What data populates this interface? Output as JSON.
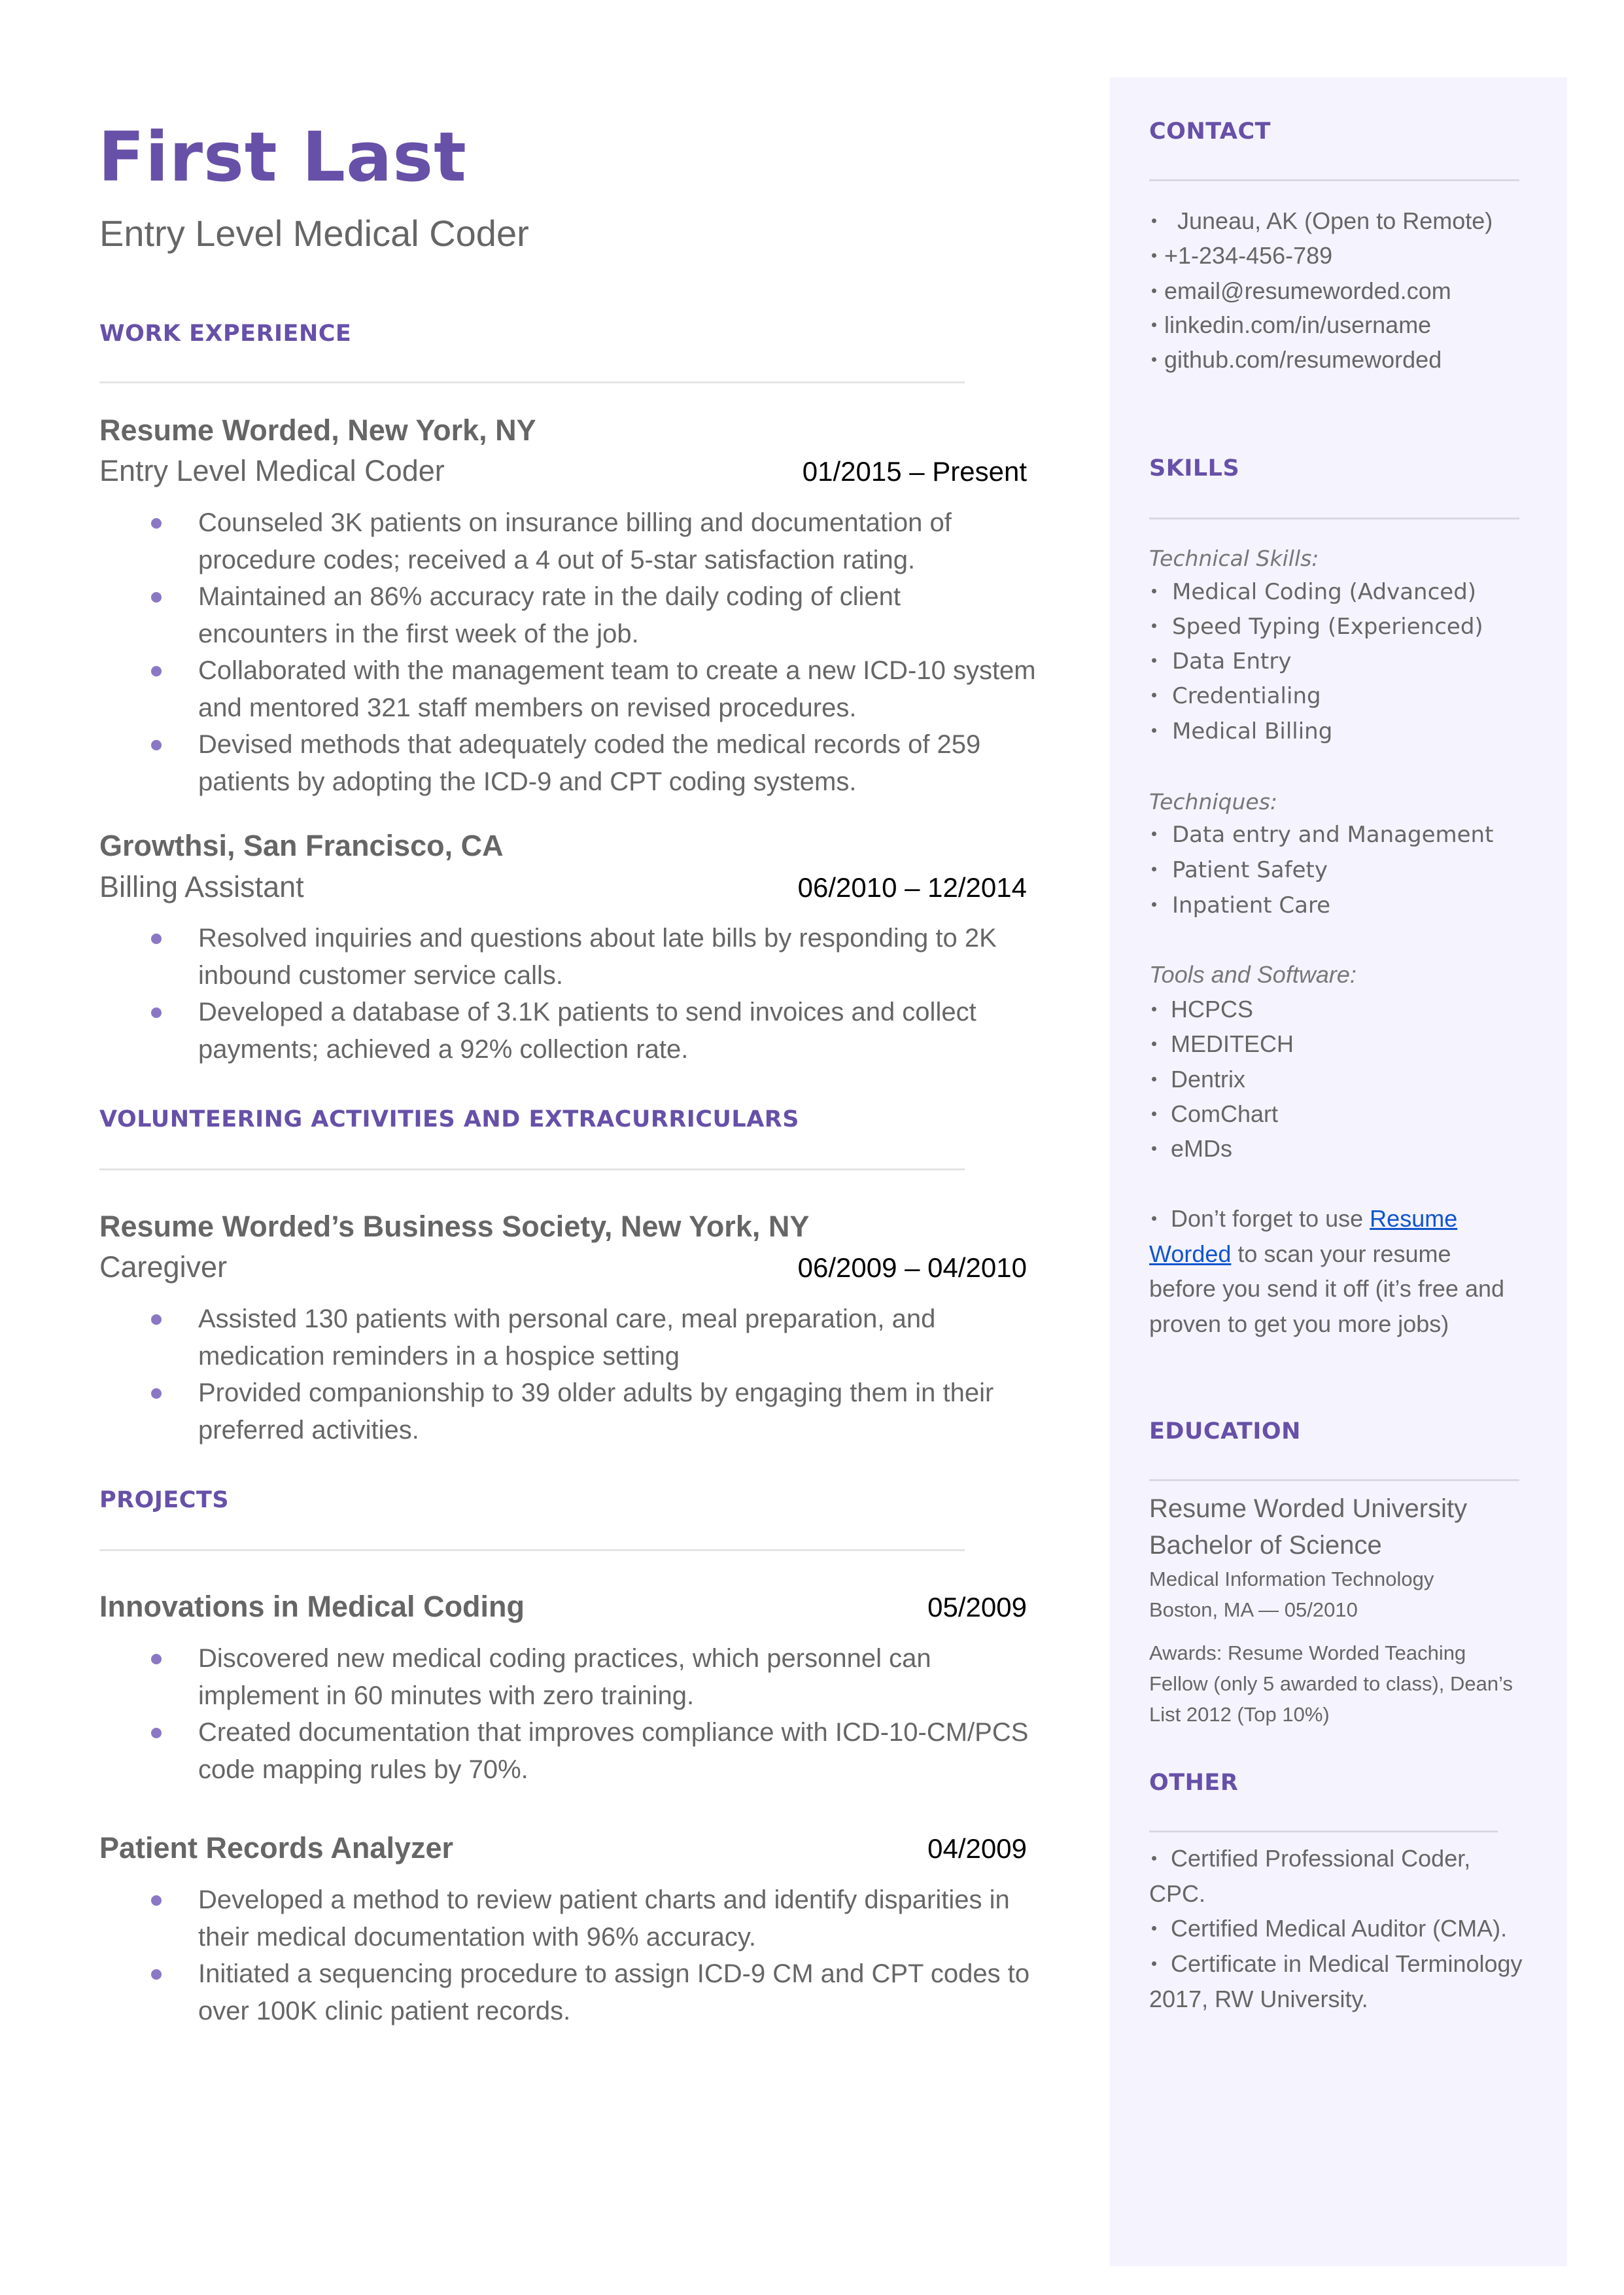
{
  "header": {
    "name": "First Last",
    "headline": "Entry Level Medical Coder"
  },
  "colors": {
    "accent": "#6750a8",
    "bullet": "#8b78c4",
    "sidebar_bg": "#f5f3fe",
    "link": "#1155cc",
    "text": "#666666"
  },
  "work": {
    "title": "WORK EXPERIENCE",
    "jobs": [
      {
        "org": "Resume Worded, New York, NY",
        "role": "Entry Level Medical Coder",
        "dates": "01/2015 – Present",
        "bullets": [
          "Counseled 3K patients on insurance billing and documentation of procedure codes; received a 4 out of 5-star satisfaction rating.",
          "Maintained an 86% accuracy rate in the daily coding of client encounters in the first week of the job.",
          "Collaborated with the management team to create a new ICD-10 system and mentored 321 staff members on revised procedures.",
          "Devised methods that adequately coded the medical records of 259 patients by adopting the ICD-9 and CPT coding systems."
        ]
      },
      {
        "org": "Growthsi, San Francisco, CA",
        "role": "Billing Assistant",
        "dates": "06/2010 – 12/2014",
        "bullets": [
          "Resolved inquiries and questions about late bills by responding to 2K inbound customer service calls.",
          "Developed a database of 3.1K patients to send invoices and collect payments; achieved a 92% collection rate."
        ]
      }
    ]
  },
  "volunteering": {
    "title": "VOLUNTEERING ACTIVITIES AND EXTRACURRICULARS",
    "entries": [
      {
        "org": "Resume Worded’s Business Society, New York, NY",
        "role": "Caregiver",
        "dates": "06/2009 – 04/2010",
        "bullets": [
          "Assisted 130 patients with personal care, meal preparation, and medication reminders in a hospice setting",
          "Provided companionship to 39 older adults by engaging them in their preferred activities."
        ]
      }
    ]
  },
  "projects": {
    "title": "PROJECTS",
    "entries": [
      {
        "name": "Innovations in Medical Coding",
        "date": "05/2009",
        "bullets": [
          "Discovered new medical coding practices, which personnel can implement in 60 minutes with zero training.",
          "Created documentation that improves compliance with ICD-10-CM/PCS code mapping rules by 70%."
        ]
      },
      {
        "name": "Patient Records Analyzer",
        "date": "04/2009",
        "bullets": [
          "Developed a method to review patient charts and identify disparities in their medical documentation with 96% accuracy.",
          "Initiated a sequencing procedure to assign ICD-9 CM and CPT codes to over 100K clinic patient records."
        ]
      }
    ]
  },
  "sidebar": {
    "contact": {
      "title": "CONTACT",
      "items": [
        " Juneau, AK (Open to Remote)",
        "+1-234-456-789",
        "email@resumeworded.com",
        "linkedin.com/in/username",
        "github.com/resumeworded"
      ]
    },
    "skills": {
      "title": "SKILLS",
      "groups": [
        {
          "label": "Technical Skills:",
          "items": [
            "Medical Coding (Advanced)",
            "Speed Typing (Experienced)",
            "Data Entry",
            "Credentialing",
            "Medical Billing"
          ]
        },
        {
          "label": "Techniques:",
          "items": [
            "Data entry and Management",
            "Patient Safety",
            "Inpatient Care"
          ]
        },
        {
          "label": "Tools and Software:",
          "items": [
            "HCPCS",
            "MEDITECH",
            "Dentrix",
            "ComChart",
            "eMDs"
          ]
        }
      ],
      "note": {
        "prefix": "Don’t forget to use ",
        "link_text": "Resume Worded",
        "suffix": " to scan your resume before you send it off (it’s free and proven to get you more jobs)"
      }
    },
    "education": {
      "title": "EDUCATION",
      "school": "Resume Worded University",
      "degree": "Bachelor of Science",
      "field": "Medical Information Technology",
      "location_date": "Boston, MA — 05/2010",
      "awards": "Awards: Resume Worded Teaching Fellow (only 5 awarded to class), Dean’s List 2012 (Top 10%)"
    },
    "other": {
      "title": "OTHER",
      "items": [
        "Certified Professional Coder, CPC.",
        "Certified Medical Auditor (CMA).",
        "Certificate in Medical Terminology 2017, RW University."
      ]
    }
  }
}
